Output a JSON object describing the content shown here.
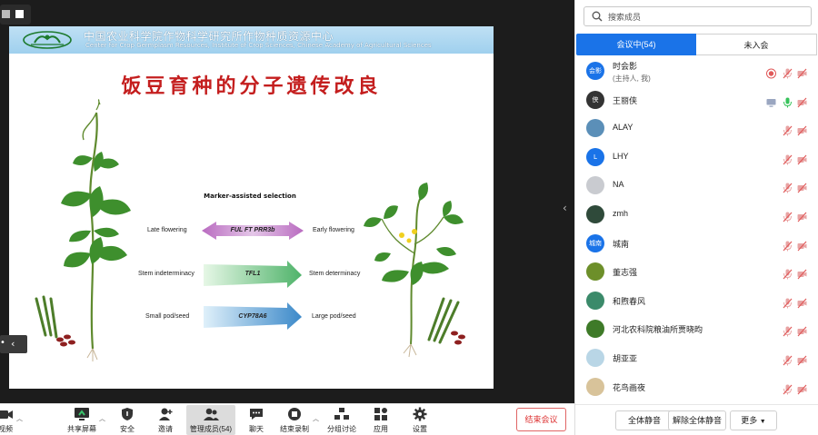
{
  "slide": {
    "institution_zh": "中国农业科学院作物科学研究所作物种质资源中心",
    "institution_en": "Center for Crop Germplasm Resources, Institute of Crop Sciences, Chinese Academy of Agricultural Sciences",
    "title": "饭豆育种的分子遗传改良",
    "diagram_heading": "Marker-assisted selection",
    "traits": [
      {
        "from": "Late flowering",
        "genes": "FUL    FT   PRR3b",
        "to": "Early flowering"
      },
      {
        "from": "Stem indeterminacy",
        "genes": "TFL1",
        "to": "Stem determinacy"
      },
      {
        "from": "Small pod/seed",
        "genes": "CYP78A6",
        "to": "Large pod/seed"
      }
    ]
  },
  "toolbar": {
    "items": [
      {
        "label": "视频",
        "icon": "video-icon"
      },
      {
        "label": "共享屏幕",
        "icon": "share-screen-icon"
      },
      {
        "label": "安全",
        "icon": "shield-icon"
      },
      {
        "label": "邀请",
        "icon": "invite-icon"
      },
      {
        "label": "管理成员(54)",
        "icon": "members-icon"
      },
      {
        "label": "聊天",
        "icon": "chat-icon"
      },
      {
        "label": "结束录制",
        "icon": "stop-record-icon"
      },
      {
        "label": "分组讨论",
        "icon": "breakout-icon"
      },
      {
        "label": "应用",
        "icon": "apps-icon"
      },
      {
        "label": "设置",
        "icon": "gear-icon"
      }
    ],
    "end_meeting": "结束会议"
  },
  "panel": {
    "search_placeholder": "搜索成员",
    "tab_in": "会议中(54)",
    "tab_out": "未入会",
    "members": [
      {
        "name": "时会影",
        "sub": "(主持人, 我)",
        "avatar_text": "会影",
        "avatar_color": "#1a73e8",
        "recording": true
      },
      {
        "name": "王丽侠",
        "avatar_text": "侠",
        "avatar_color": "#333333",
        "speaking": true
      },
      {
        "name": "ALAY",
        "avatar_text": "",
        "avatar_color": "#5b8fb8"
      },
      {
        "name": "LHY",
        "avatar_text": "L",
        "avatar_color": "#1a73e8"
      },
      {
        "name": "NA",
        "avatar_text": "",
        "avatar_color": "#c9cbd0"
      },
      {
        "name": "zmh",
        "avatar_text": "",
        "avatar_color": "#2f4a3a"
      },
      {
        "name": "城南",
        "avatar_text": "城南",
        "avatar_color": "#1a73e8"
      },
      {
        "name": "董志强",
        "avatar_text": "",
        "avatar_color": "#6d8f2a"
      },
      {
        "name": "和煦春风",
        "avatar_text": "",
        "avatar_color": "#3b8a6a"
      },
      {
        "name": "河北农科院粮油所贾晓昀",
        "avatar_text": "",
        "avatar_color": "#3e7a28"
      },
      {
        "name": "胡亚亚",
        "avatar_text": "",
        "avatar_color": "#b9d6e6"
      },
      {
        "name": "花鸟画夜",
        "avatar_text": "",
        "avatar_color": "#d8c39a"
      }
    ],
    "mute_all": "全体静音",
    "unmute_all": "解除全体静音",
    "more": "更多"
  },
  "colors": {
    "accent": "#1a73e8",
    "danger": "#e05a5a",
    "slide_title": "#c41e1e"
  }
}
